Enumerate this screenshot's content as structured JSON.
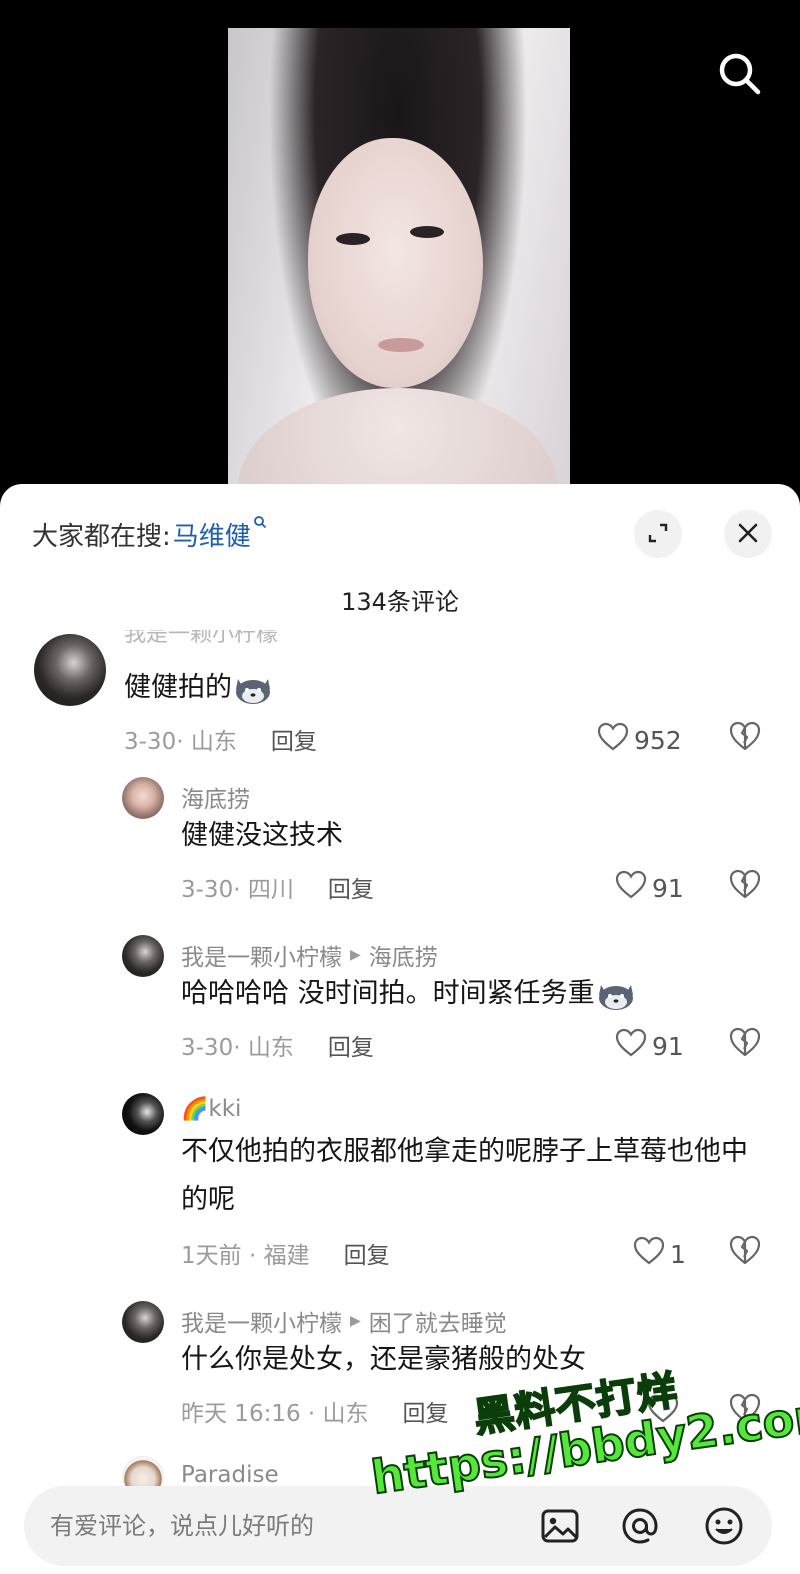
{
  "search": {
    "icon": "search-icon"
  },
  "sheet": {
    "trend_label": "大家都在搜:",
    "trend_link": "马维健",
    "count_title": "134条评论"
  },
  "comments": [
    {
      "name_partial": "我是一颗小柠檬",
      "text": "健健拍的",
      "emoji": "husky-emoji",
      "time": "3-30· 山东",
      "reply": "回复",
      "likes": "952"
    },
    {
      "name": "海底捞",
      "text": "健健没这技术",
      "time": "3-30· 四川",
      "reply": "回复",
      "likes": "91"
    },
    {
      "name": "我是一颗小柠檬",
      "reply_to": "海底捞",
      "text": "哈哈哈哈 没时间拍。时间紧任务重",
      "emoji": "husky-emoji",
      "time": "3-30· 山东",
      "reply": "回复",
      "likes": "91"
    },
    {
      "name_prefix": "🌈",
      "name": "kki",
      "text": "不仅他拍的衣服都他拿走的呢脖子上草莓也他中的呢",
      "time": "1天前 · 福建",
      "reply": "回复",
      "likes": "1"
    },
    {
      "name": "我是一颗小柠檬",
      "reply_to": "困了就去睡觉",
      "text": "什么你是处女，还是豪猪般的处女",
      "time": "昨天 16:16 · 山东",
      "reply": "回复"
    },
    {
      "name": "Paradise"
    }
  ],
  "input": {
    "placeholder": "有爱评论，说点儿好听的"
  },
  "watermark": {
    "line1": "黑料不打烊",
    "line2": "https://bbdy2.com"
  },
  "colors": {
    "link": "#1f5fae",
    "watermark": "#55e83b"
  }
}
